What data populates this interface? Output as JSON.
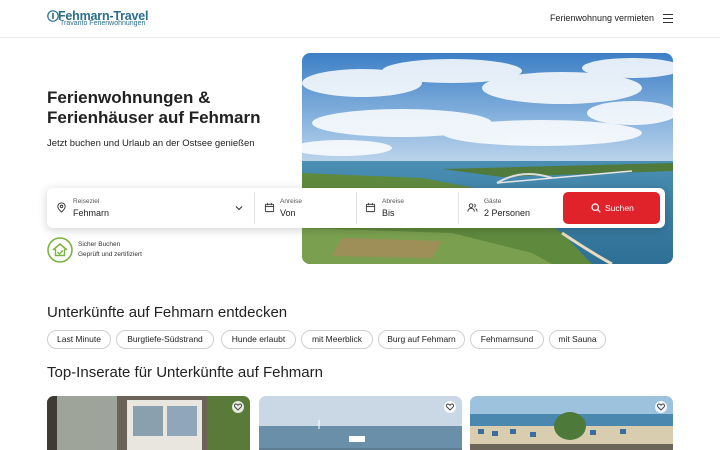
{
  "header": {
    "logo_title": "Fehmarn-Travel",
    "logo_sub": "Travanto Ferienwohnungen",
    "rent_link": "Ferienwohnung vermieten",
    "menu_icon": "hamburger-menu-icon"
  },
  "hero": {
    "title": "Ferienwohnungen & Ferienhäuser auf Fehmarn",
    "subtitle": "Jetzt buchen und Urlaub an der Ostsee genießen"
  },
  "search": {
    "destination": {
      "label": "Reiseziel",
      "value": "Fehmarn",
      "icon": "location-pin-icon"
    },
    "arrival": {
      "label": "Anreise",
      "value": "Von",
      "icon": "calendar-icon"
    },
    "departure": {
      "label": "Abreise",
      "value": "Bis",
      "icon": "calendar-icon"
    },
    "guests": {
      "label": "Gäste",
      "value": "2 Personen",
      "icon": "users-icon"
    },
    "button_label": "Suchen",
    "button_color": "#e0232b"
  },
  "badge": {
    "line1": "Sicher Buchen",
    "line2": "Geprüft und zertifiziert",
    "icon": "verified-house-icon"
  },
  "discover": {
    "title": "Unterkünfte auf Fehmarn entdecken",
    "chips": [
      "Last Minute",
      "Burgtiefe-Südstrand",
      "Hunde erlaubt",
      "mit Meerblick",
      "Burg auf Fehmarn",
      "Fehmarnsund",
      "mit Sauna"
    ]
  },
  "top_listings": {
    "title": "Top-Inserate für Unterkünfte auf Fehmarn",
    "cards": [
      {
        "icon": "heart-icon"
      },
      {
        "icon": "heart-icon"
      },
      {
        "icon": "heart-icon"
      }
    ]
  }
}
